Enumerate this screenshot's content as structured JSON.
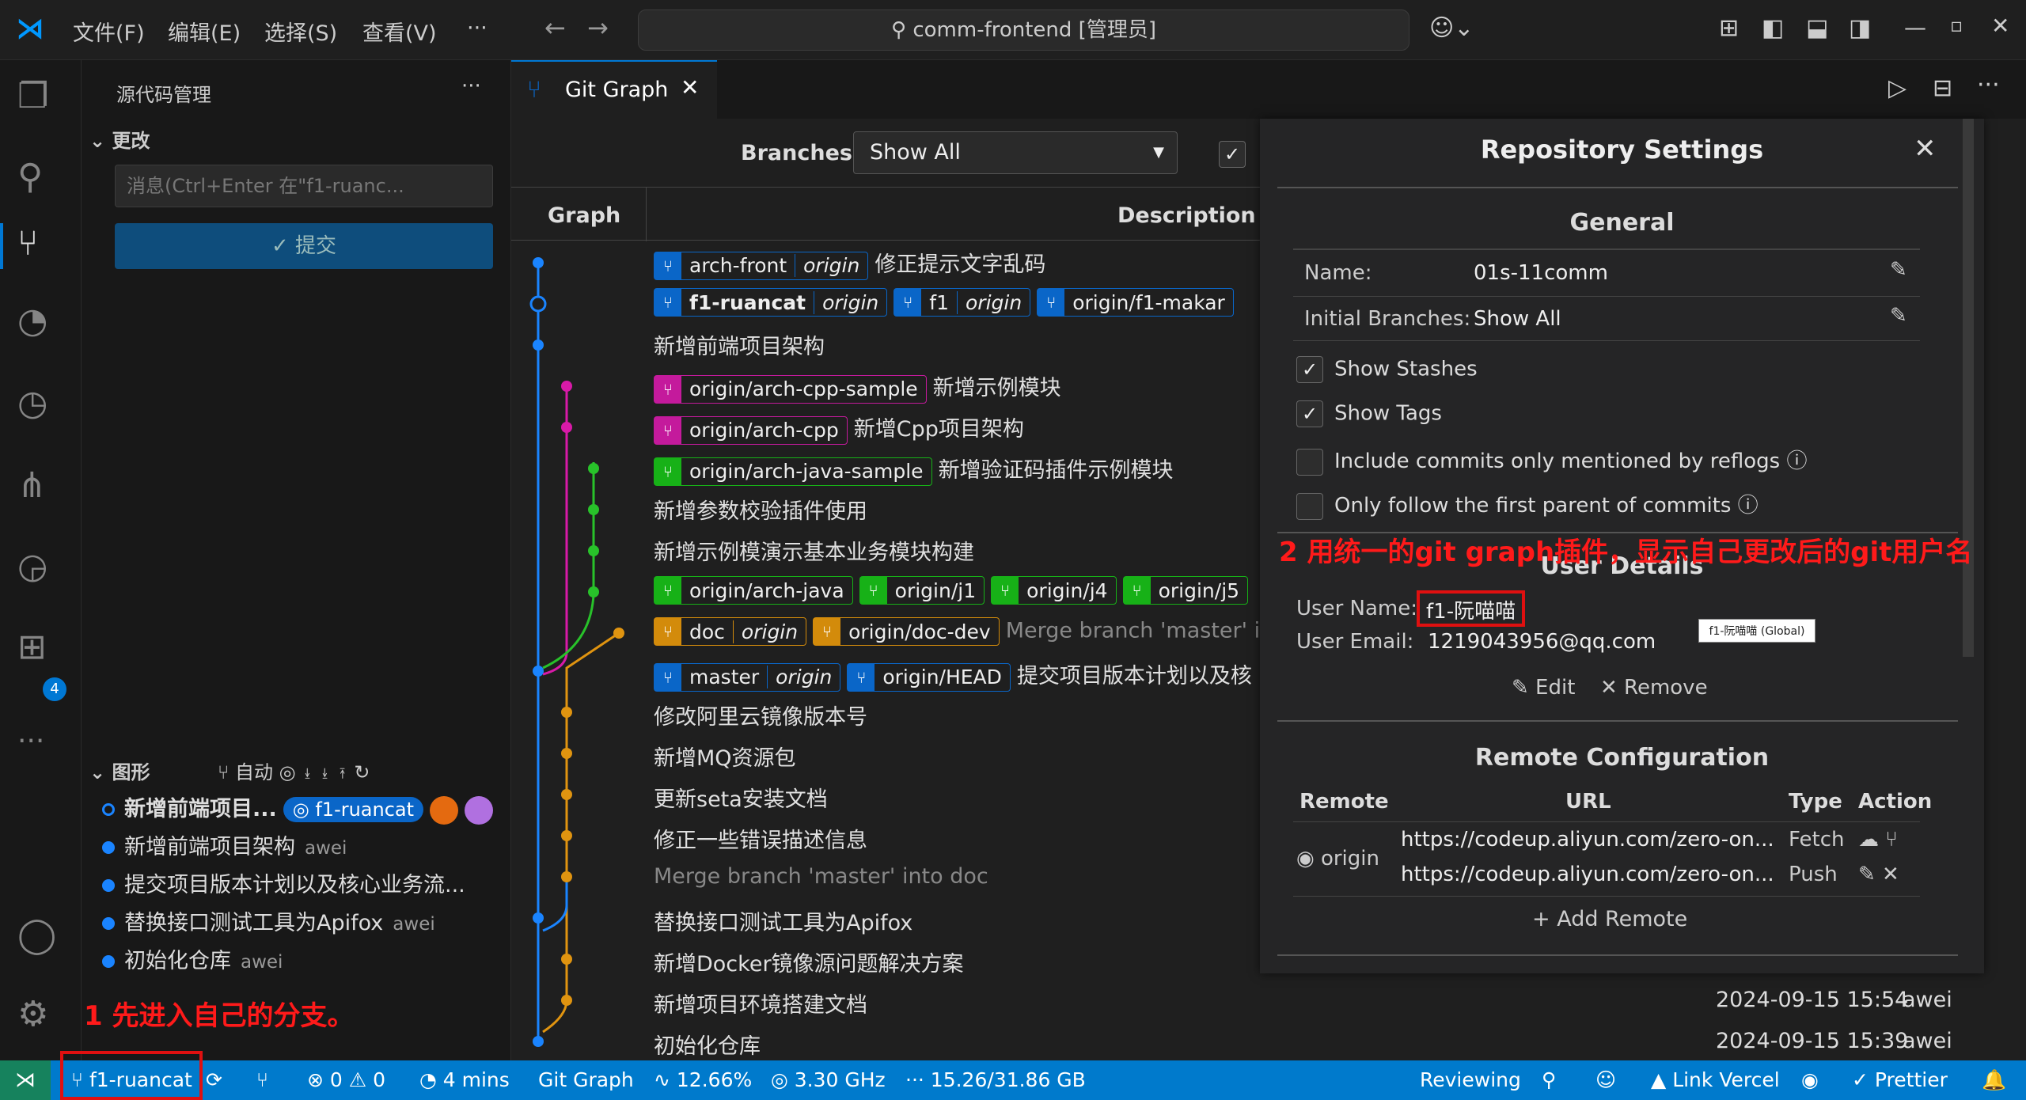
{
  "menu": [
    "文件(F)",
    "编辑(E)",
    "选择(S)",
    "查看(V)",
    "···"
  ],
  "search": "comm-frontend [管理员]",
  "badge": "4",
  "scm": {
    "title": "源代码管理",
    "changes": "更改",
    "msg_placeholder": "消息(Ctrl+Enter 在\"f1-ruanc...",
    "commit": "✓ 提交",
    "graph": "图形",
    "auto": "自动",
    "items": [
      {
        "t": "新增前端项目...",
        "tag": "◎ f1-ruancat"
      },
      {
        "t": "新增前端项目架构",
        "a": "awei"
      },
      {
        "t": "提交项目版本计划以及核心业务流...",
        "a": ""
      },
      {
        "t": "替换接口测试工具为Apifox",
        "a": "awei"
      },
      {
        "t": "初始化仓库",
        "a": "awei"
      }
    ]
  },
  "tab": "Git Graph",
  "branches_label": "Branches:",
  "branches_value": "Show All",
  "col_graph": "Graph",
  "col_desc": "Description",
  "rows": [
    {
      "pills": [
        [
          "arch-front",
          "origin",
          "#0a66c8"
        ]
      ],
      "t": "修正提示文字乱码"
    },
    {
      "pills": [
        [
          "f1-ruancat",
          "origin",
          "#0a66c8"
        ],
        [
          "f1",
          "origin",
          "#0a66c8"
        ],
        [
          "origin/f1-makar",
          "",
          "#0a66c8"
        ]
      ],
      "t": ""
    },
    {
      "pills": [],
      "t": "新增前端项目架构"
    },
    {
      "pills": [
        [
          "origin/arch-cpp-sample",
          "",
          "#c41a9c"
        ]
      ],
      "t": "新增示例模块"
    },
    {
      "pills": [
        [
          "origin/arch-cpp",
          "",
          "#c41a9c"
        ]
      ],
      "t": "新增Cpp项目架构"
    },
    {
      "pills": [
        [
          "origin/arch-java-sample",
          "",
          "#17b117"
        ]
      ],
      "t": "新增验证码插件示例模块"
    },
    {
      "pills": [],
      "t": "新增参数校验插件使用"
    },
    {
      "pills": [],
      "t": "新增示例模演示基本业务模块构建"
    },
    {
      "pills": [
        [
          "origin/arch-java",
          "",
          "#17b117"
        ],
        [
          "origin/j1",
          "",
          "#17b117"
        ],
        [
          "origin/j4",
          "",
          "#17b117"
        ],
        [
          "origin/j5",
          "",
          "#17b117"
        ]
      ],
      "t": ""
    },
    {
      "pills": [
        [
          "doc",
          "origin",
          "#d38b0b"
        ],
        [
          "origin/doc-dev",
          "",
          "#d38b0b"
        ]
      ],
      "t": "Merge branch 'master' int",
      "dim": true
    },
    {
      "pills": [
        [
          "master",
          "origin",
          "#0a66c8"
        ],
        [
          "origin/HEAD",
          "",
          "#0a66c8"
        ]
      ],
      "t": "提交项目版本计划以及核"
    },
    {
      "pills": [],
      "t": "修改阿里云镜像版本号"
    },
    {
      "pills": [],
      "t": "新增MQ资源包"
    },
    {
      "pills": [],
      "t": "更新seta安装文档"
    },
    {
      "pills": [],
      "t": "修正一些错误描述信息"
    },
    {
      "pills": [],
      "t": "Merge branch 'master' into doc",
      "dim": true
    },
    {
      "pills": [],
      "t": "替换接口测试工具为Apifox"
    },
    {
      "pills": [],
      "t": "新增Docker镜像源问题解决方案"
    },
    {
      "pills": [],
      "t": "新增项目环境搭建文档"
    },
    {
      "pills": [],
      "t": "初始化仓库"
    }
  ],
  "dates": [
    {
      "d": "2024-09-15 15:54",
      "a": "awei"
    },
    {
      "d": "2024-09-15 15:39",
      "a": "awei"
    }
  ],
  "settings": {
    "title": "Repository Settings",
    "general": "General",
    "name_l": "Name:",
    "name_v": "01s-11comm",
    "ib_l": "Initial Branches:",
    "ib_v": "Show All",
    "opts": [
      {
        "t": "Show Stashes",
        "c": true
      },
      {
        "t": "Show Tags",
        "c": true
      },
      {
        "t": "Include commits only mentioned by reflogs ⓘ",
        "c": false
      },
      {
        "t": "Only follow the first parent of commits ⓘ",
        "c": false
      }
    ],
    "user_details": "User Details",
    "un_l": "User Name:",
    "un_v": "f1-阮喵喵",
    "ue_l": "User Email:",
    "ue_v": "1219043956@qq.com",
    "tooltip": "f1-阮喵喵 (Global)",
    "edit": "✎ Edit",
    "remove": "✕ Remove",
    "remote_cfg": "Remote Configuration",
    "h_remote": "Remote",
    "h_url": "URL",
    "h_type": "Type",
    "h_action": "Action",
    "remote": "origin",
    "url1": "https://codeup.aliyun.com/zero-on...",
    "url2": "https://codeup.aliyun.com/zero-on...",
    "fetch": "Fetch",
    "push": "Push",
    "add": "+ Add Remote"
  },
  "ann1": "1 先进入自己的分支。",
  "ann2": "2 用统一的git graph插件，显示自己更改后的git用户名",
  "status": {
    "branch": "f1-ruancat",
    "problems": "⊗ 0 ⚠ 0",
    "time": "4 mins",
    "gitgraph": "Git Graph",
    "cpu": "12.66%",
    "ghz": "3.30 GHz",
    "mem": "15.26/31.86 GB",
    "reviewing": "Reviewing",
    "vercel": "Link Vercel",
    "prettier": "Prettier"
  }
}
